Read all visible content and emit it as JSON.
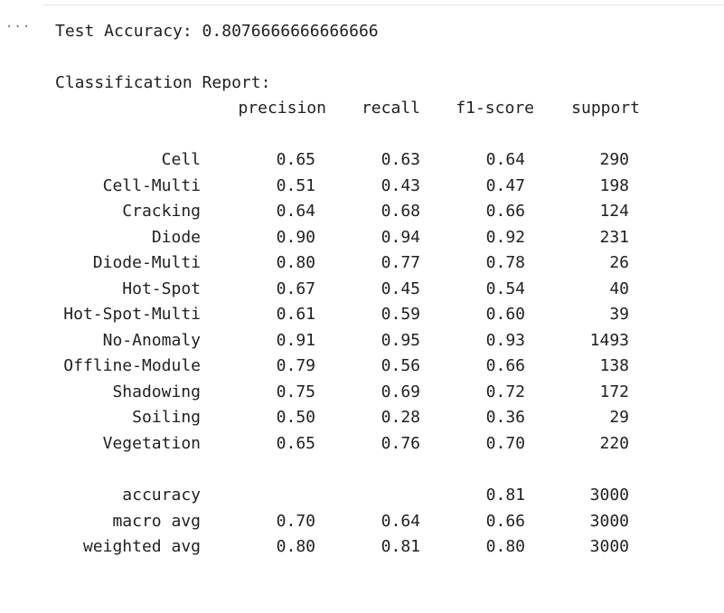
{
  "output_toggle": "···",
  "accuracy_line": "Test Accuracy: 0.8076666666666666",
  "report_title": "Classification Report:",
  "headers": {
    "precision": "precision",
    "recall": "recall",
    "f1": "f1-score",
    "support": "support"
  },
  "rows": [
    {
      "label": "Cell",
      "precision": "0.65",
      "recall": "0.63",
      "f1": "0.64",
      "support": "290"
    },
    {
      "label": "Cell-Multi",
      "precision": "0.51",
      "recall": "0.43",
      "f1": "0.47",
      "support": "198"
    },
    {
      "label": "Cracking",
      "precision": "0.64",
      "recall": "0.68",
      "f1": "0.66",
      "support": "124"
    },
    {
      "label": "Diode",
      "precision": "0.90",
      "recall": "0.94",
      "f1": "0.92",
      "support": "231"
    },
    {
      "label": "Diode-Multi",
      "precision": "0.80",
      "recall": "0.77",
      "f1": "0.78",
      "support": "26"
    },
    {
      "label": "Hot-Spot",
      "precision": "0.67",
      "recall": "0.45",
      "f1": "0.54",
      "support": "40"
    },
    {
      "label": "Hot-Spot-Multi",
      "precision": "0.61",
      "recall": "0.59",
      "f1": "0.60",
      "support": "39"
    },
    {
      "label": "No-Anomaly",
      "precision": "0.91",
      "recall": "0.95",
      "f1": "0.93",
      "support": "1493"
    },
    {
      "label": "Offline-Module",
      "precision": "0.79",
      "recall": "0.56",
      "f1": "0.66",
      "support": "138"
    },
    {
      "label": "Shadowing",
      "precision": "0.75",
      "recall": "0.69",
      "f1": "0.72",
      "support": "172"
    },
    {
      "label": "Soiling",
      "precision": "0.50",
      "recall": "0.28",
      "f1": "0.36",
      "support": "29"
    },
    {
      "label": "Vegetation",
      "precision": "0.65",
      "recall": "0.76",
      "f1": "0.70",
      "support": "220"
    }
  ],
  "summary": [
    {
      "label": "accuracy",
      "precision": "",
      "recall": "",
      "f1": "0.81",
      "support": "3000"
    },
    {
      "label": "macro avg",
      "precision": "0.70",
      "recall": "0.64",
      "f1": "0.66",
      "support": "3000"
    },
    {
      "label": "weighted avg",
      "precision": "0.80",
      "recall": "0.81",
      "f1": "0.80",
      "support": "3000"
    }
  ]
}
